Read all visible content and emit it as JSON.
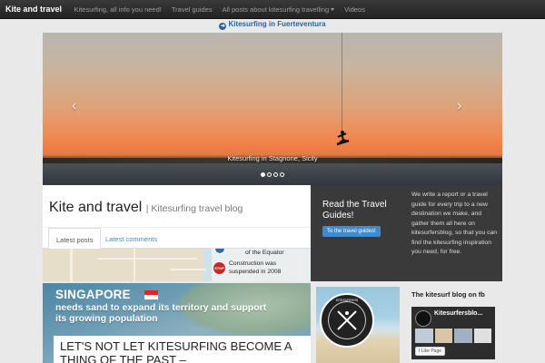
{
  "navbar": {
    "brand": "Kite and travel",
    "items": [
      {
        "label": "Kitesurfing, all info you need!"
      },
      {
        "label": "Travel guides"
      },
      {
        "label": "All posts about kitesurfing travelling"
      },
      {
        "label": "Videos"
      }
    ]
  },
  "sublink": {
    "label": "Kitesurfing in Fuerteventura"
  },
  "carousel": {
    "caption": "Kitesurfing in Stagnone, Sicily",
    "slide_count": 4,
    "active_slide": 1
  },
  "header": {
    "title": "Kite and travel",
    "tagline": "| Kitesurfing travel blog"
  },
  "tabs": [
    {
      "label": "Latest posts",
      "active": true
    },
    {
      "label": "Latest comments",
      "active": false
    }
  ],
  "guides": {
    "title": "Read the Travel Guides!",
    "button": "To the travel guides!",
    "description": "We write a report or a travel guide for every trip to a new destination we make, and gather them all here on kitesurfersblog, so that you can find the kitesurfing inspiration you need, for free."
  },
  "map_post": {
    "line1": "of the Equator",
    "line2": "Construction was",
    "line3": "suspended in 2008",
    "stop_label": "STOP"
  },
  "singapore_post": {
    "title": "SINGAPORE",
    "subtitle": "needs sand to expand its territory and support its growing population"
  },
  "article": {
    "title": "LET'S NOT LET KITESURFING BECOME A THING OF THE PAST –"
  },
  "kite_photo": {
    "badge_text": "KITESURFERS"
  },
  "facebook": {
    "title": "The kitesurf blog on fb",
    "page_name": "Kitesurfersblo...",
    "like_label": "Like Page"
  },
  "colors": {
    "navbar": "#222222",
    "link": "#428bca",
    "dark_panel": "#3a3a3a"
  }
}
